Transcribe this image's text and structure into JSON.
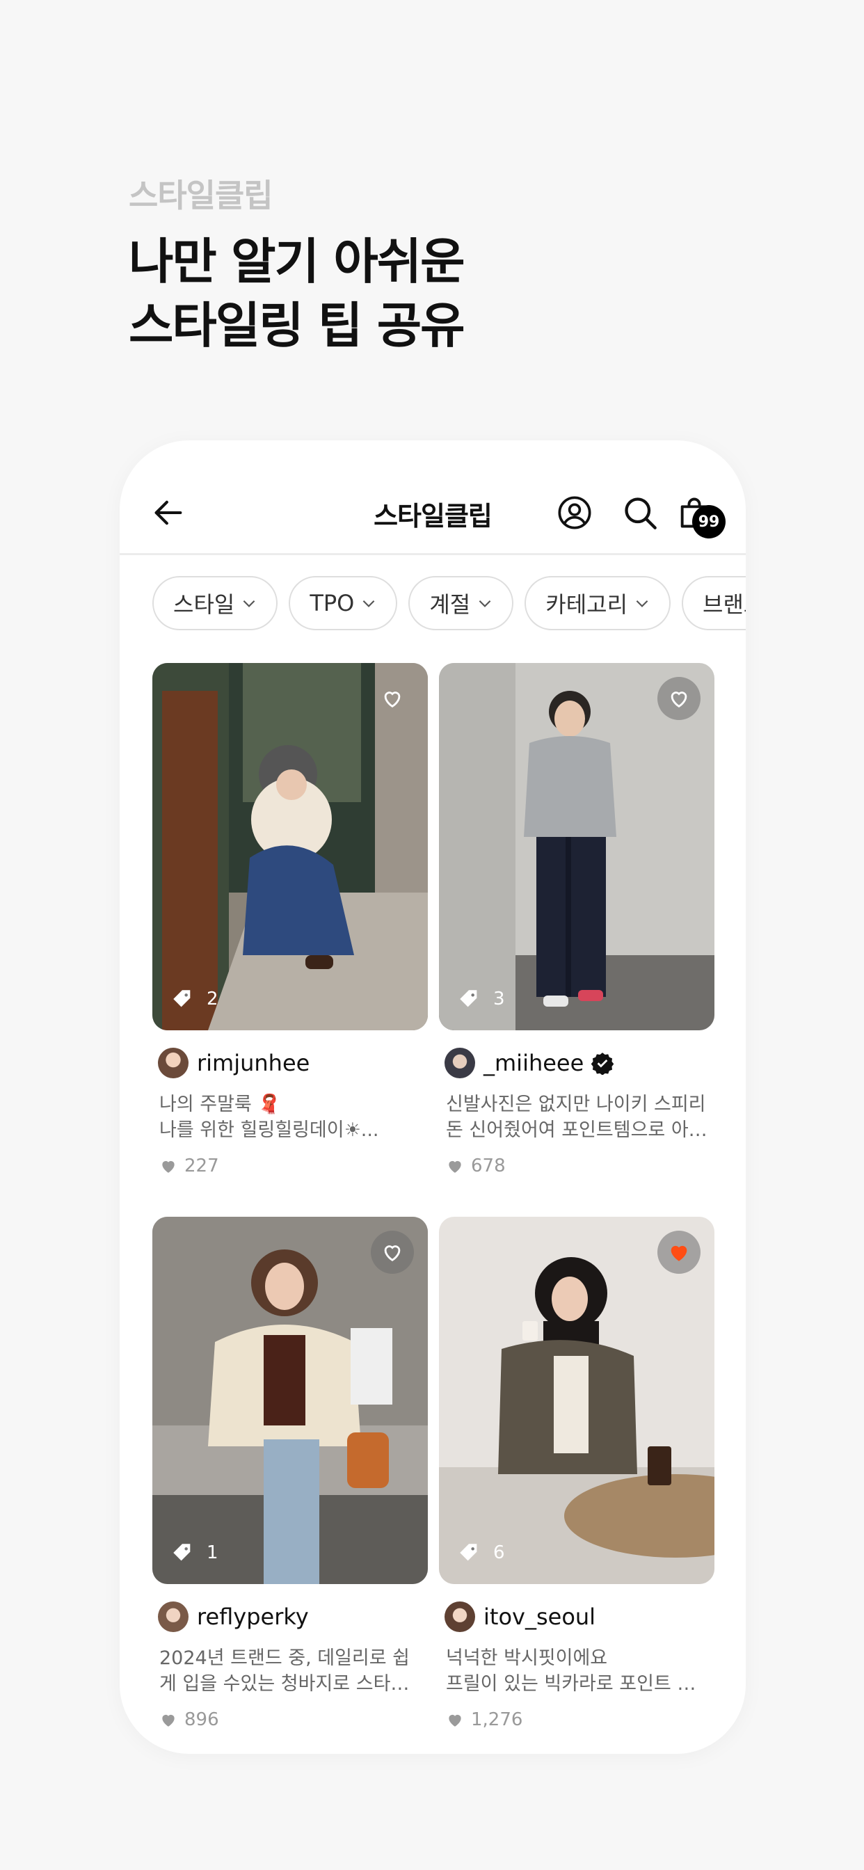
{
  "promo": {
    "subtitle": "스타일클립",
    "title_line1": "나만 알기 아쉬운",
    "title_line2": "스타일링 팁 공유"
  },
  "header": {
    "title": "스타일클립",
    "cart_count": "99",
    "icons": [
      "arrow-left-icon",
      "profile-icon",
      "search-icon",
      "shopping-bag-icon"
    ]
  },
  "filters": [
    "스타일",
    "TPO",
    "계절",
    "카테고리",
    "브랜드"
  ],
  "posts": [
    {
      "username": "rimjunhee",
      "desc_line1": "나의 주말룩 🧣",
      "desc_line2": "나를 위한 힐링힐링데이☀...",
      "likes": "227",
      "tags": "2",
      "liked": false,
      "verified": false
    },
    {
      "username": "_miiheee",
      "desc_line1": "신발사진은 없지만 나이키 스피리",
      "desc_line2": "돈 신어줬어여 포인트템으로 아 ...",
      "likes": "678",
      "tags": "3",
      "liked": false,
      "verified": true
    },
    {
      "username": "reflyperky",
      "desc_line1": "2024년 트랜드 중, 데일리로 쉽",
      "desc_line2": "게 입을 수있는 청바지로 스타일...",
      "likes": "896",
      "tags": "1",
      "liked": false,
      "verified": false
    },
    {
      "username": "itov_seoul",
      "desc_line1": "넉넉한 박시핏이에요",
      "desc_line2": "프릴이 있는 빅카라로 포인트 주...",
      "likes": "1,276",
      "tags": "6",
      "liked": true,
      "verified": false
    }
  ],
  "colors": {
    "liked_heart": "#ff4d14",
    "badge_bg": "#000000",
    "page_bg": "#f7f7f7"
  }
}
